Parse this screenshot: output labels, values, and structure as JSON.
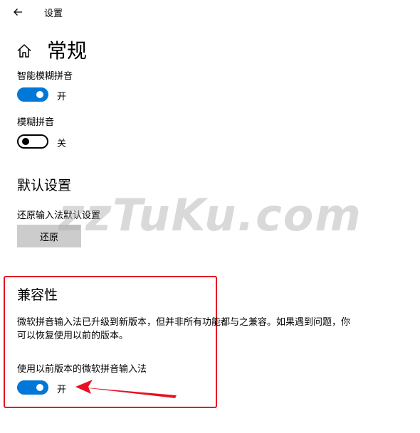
{
  "titlebar": {
    "title": "设置",
    "back_icon": "arrow-left-icon"
  },
  "page": {
    "title": "常规",
    "icon": "home-icon"
  },
  "fuzzy_smart": {
    "label": "智能模糊拼音",
    "state": true,
    "state_label": "开"
  },
  "fuzzy": {
    "label": "模糊拼音",
    "state": false,
    "state_label": "关"
  },
  "defaults": {
    "title": "默认设置",
    "restore_label": "还原输入法默认设置",
    "restore_button": "还原"
  },
  "compat": {
    "title": "兼容性",
    "description": "微软拼音输入法已升级到新版本，但并非所有功能都与之兼容。如果遇到问题，你可以恢复使用以前的版本。",
    "toggle_label": "使用以前版本的微软拼音输入法",
    "state": true,
    "state_label": "开"
  },
  "watermark": "zzTuKu.com",
  "colors": {
    "accent": "#0078d7",
    "highlight": "#e81123"
  }
}
